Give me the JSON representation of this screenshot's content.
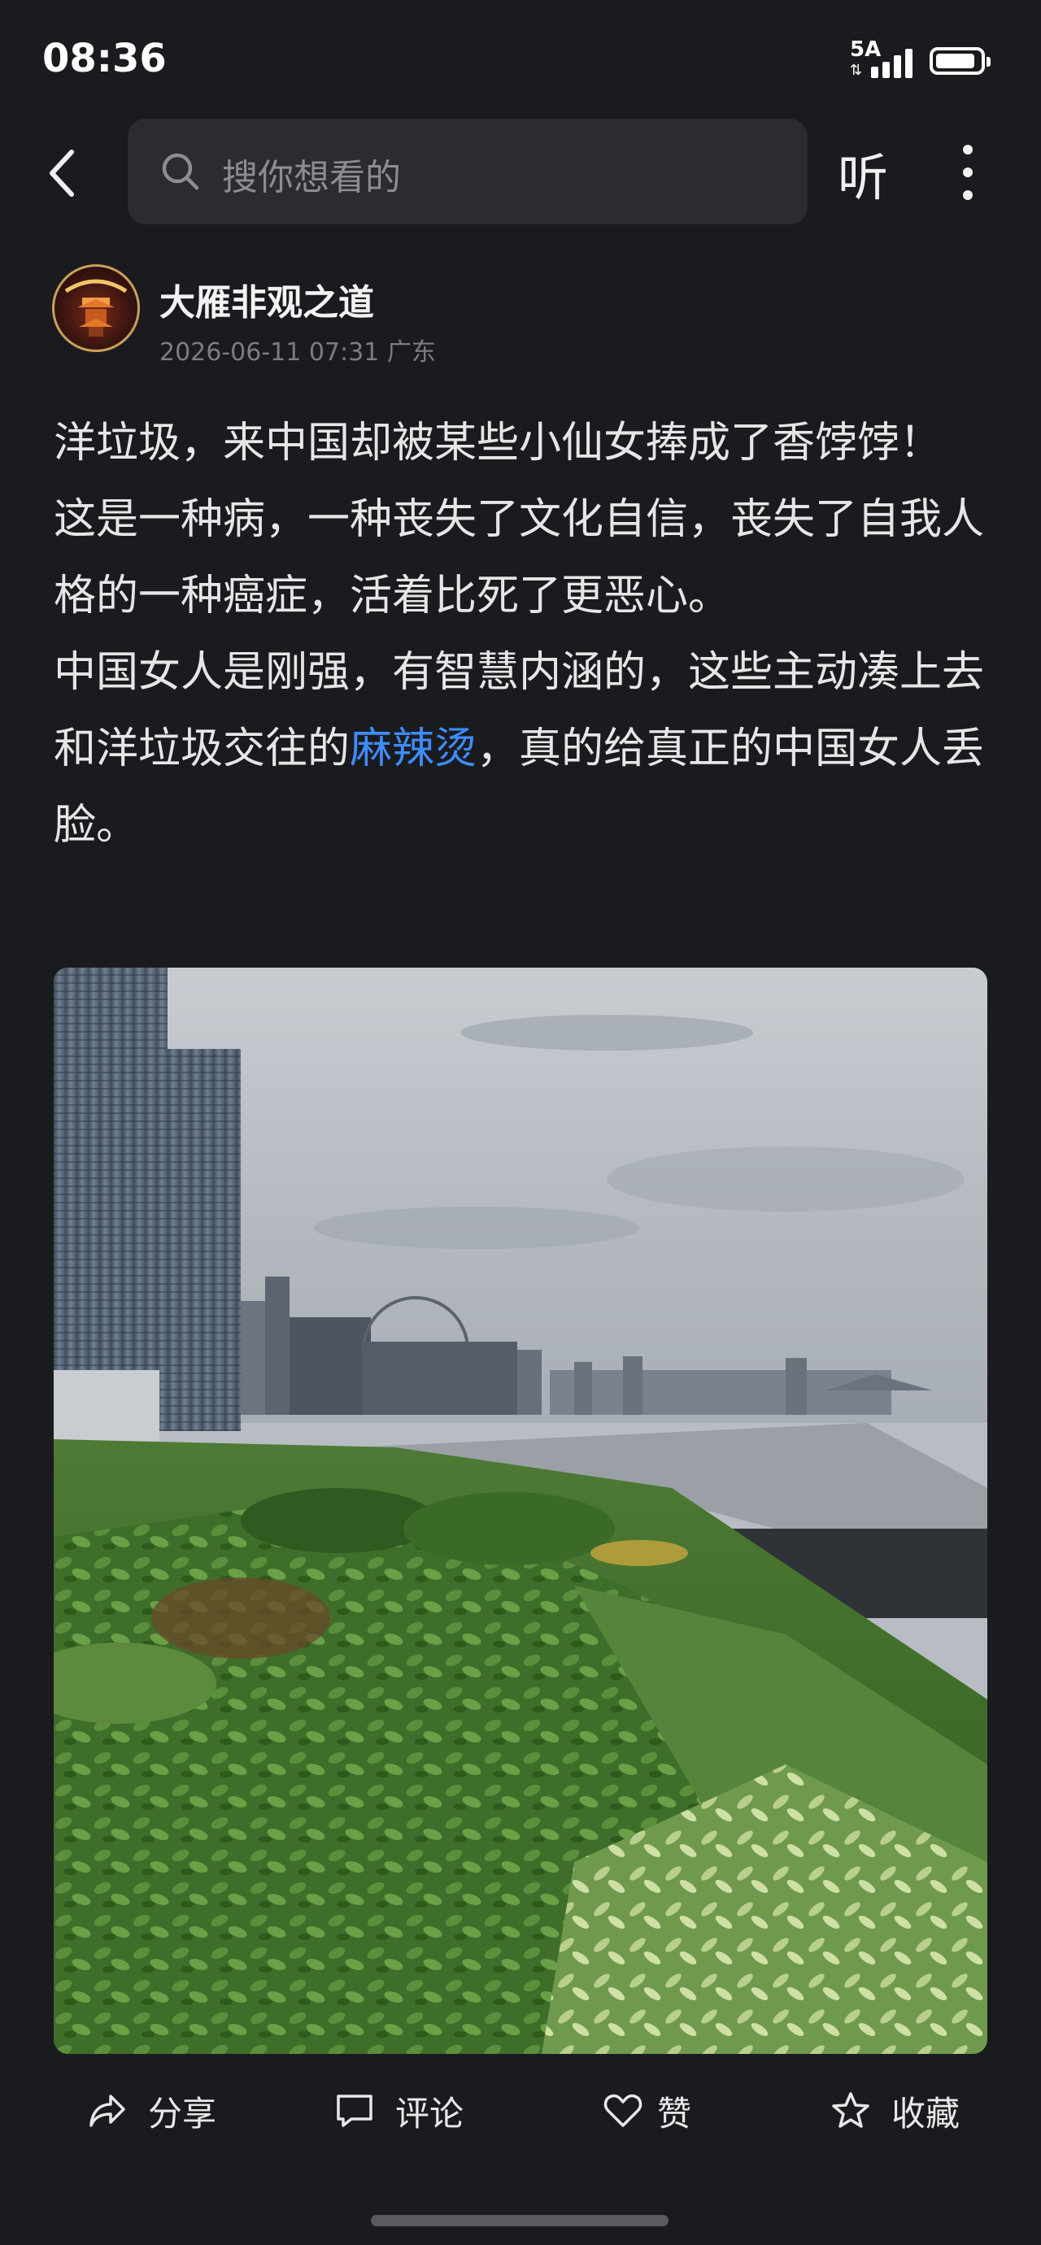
{
  "status_bar": {
    "time": "08:36",
    "network": "5A",
    "battery_level": 0.9
  },
  "header": {
    "search_placeholder": "搜你想看的",
    "listen_label": "听",
    "icons": [
      "back-arrow-icon",
      "search-icon",
      "more-vertical-icon"
    ]
  },
  "post": {
    "author": "大雁非观之道",
    "meta": "2026-06-11 07:31 广东",
    "paragraph1": "洋垃圾，来中国却被某些小仙女捧成了香饽饽！",
    "paragraph2": "这是一种病，一种丧失了文化自信，丧失了自我人格的一种癌症，活着比死了更恶心。",
    "paragraph3_before": "中国女人是刚强，有智慧内涵的，这些主动凑上去和洋垃圾交往的",
    "paragraph3_link": "麻辣烫",
    "paragraph3_after": "，真的给真正的中国女人丢脸。"
  },
  "actions": {
    "share": "分享",
    "comment": "评论",
    "like": "赞",
    "favorite": "收藏"
  },
  "colors": {
    "background": "#1a1b1e",
    "link": "#3f8cff",
    "search_bg": "#2b2c30"
  }
}
